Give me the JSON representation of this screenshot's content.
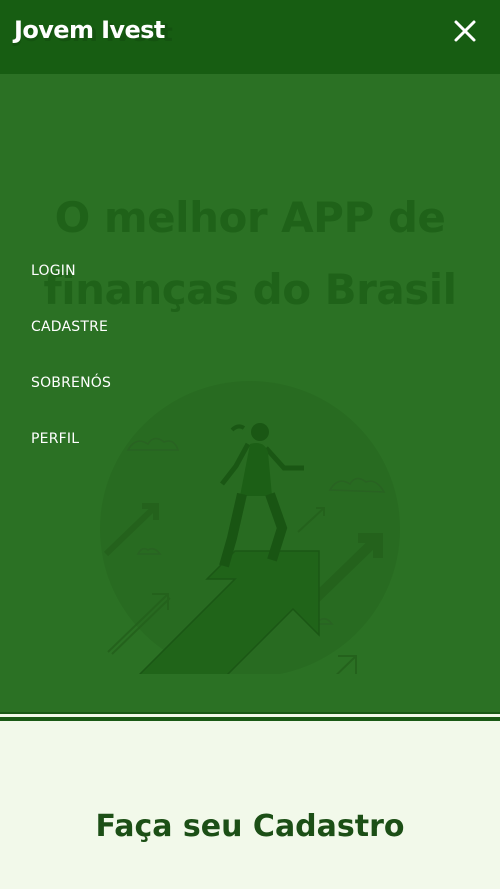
{
  "header": {
    "brand": "Jovem Ivest"
  },
  "hero": {
    "title": "O melhor APP de finanças do Brasil"
  },
  "menu": {
    "brand": "Jovem Ivest",
    "close_icon": "close-icon",
    "items": [
      {
        "label": "LOGIN"
      },
      {
        "label": "CADASTRE"
      },
      {
        "label": "SOBRENÓS"
      },
      {
        "label": "PERFIL"
      }
    ]
  },
  "signup": {
    "title": "Faça seu Cadastro"
  },
  "colors": {
    "header": "#13570f",
    "hero_bg": "#2e7227",
    "page_bg": "#f2f9ea",
    "accent_text": "#1c4f16"
  }
}
